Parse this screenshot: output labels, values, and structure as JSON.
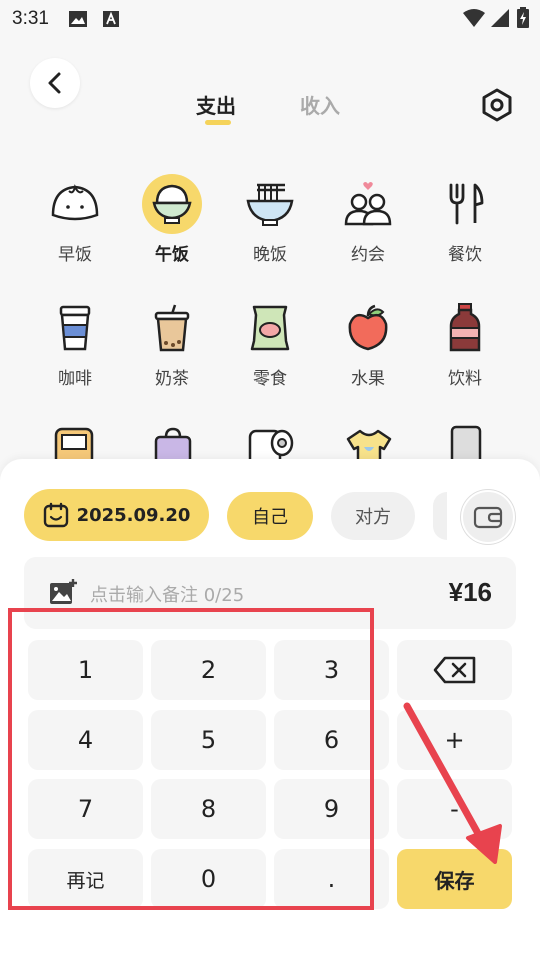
{
  "status_bar": {
    "time": "3:31"
  },
  "header": {
    "tabs": [
      {
        "label": "支出",
        "active": true
      },
      {
        "label": "收入",
        "active": false
      }
    ]
  },
  "categories": [
    {
      "label": "早饭",
      "icon": "bun-icon",
      "selected": false
    },
    {
      "label": "午饭",
      "icon": "rice-bowl-icon",
      "selected": true
    },
    {
      "label": "晚饭",
      "icon": "noodle-bowl-icon",
      "selected": false
    },
    {
      "label": "约会",
      "icon": "couple-icon",
      "selected": false
    },
    {
      "label": "餐饮",
      "icon": "fork-knife-icon",
      "selected": false
    },
    {
      "label": "咖啡",
      "icon": "coffee-cup-icon",
      "selected": false
    },
    {
      "label": "奶茶",
      "icon": "milk-tea-icon",
      "selected": false
    },
    {
      "label": "零食",
      "icon": "snack-bag-icon",
      "selected": false
    },
    {
      "label": "水果",
      "icon": "apple-icon",
      "selected": false
    },
    {
      "label": "饮料",
      "icon": "soda-bottle-icon",
      "selected": false
    }
  ],
  "panel": {
    "date": "2025.09.20",
    "payer_self": "自己",
    "payer_other": "对方",
    "note_placeholder": "点击输入备注 0/25",
    "amount": "¥16"
  },
  "keypad": {
    "k1": "1",
    "k2": "2",
    "k3": "3",
    "k4": "4",
    "k5": "5",
    "k6": "6",
    "k7": "7",
    "k8": "8",
    "k9": "9",
    "again": "再记",
    "k0": "0",
    "dot": ".",
    "plus": "+",
    "minus": "-",
    "save": "保存"
  },
  "colors": {
    "accent": "#f7d86b",
    "annotation": "#e8434e"
  }
}
